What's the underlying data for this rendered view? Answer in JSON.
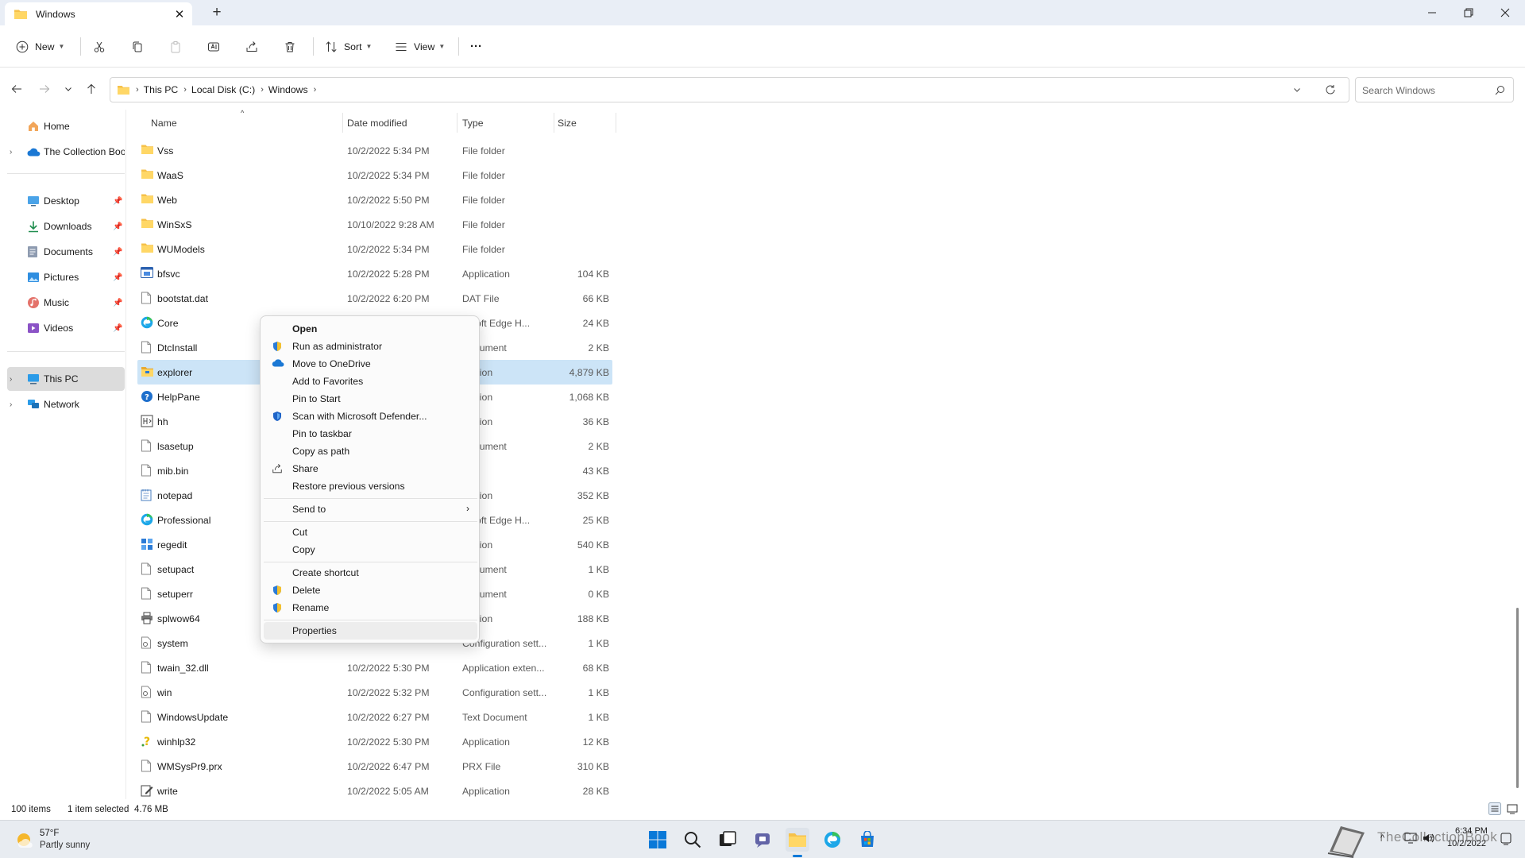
{
  "window": {
    "tab_title": "Windows",
    "new_tab": "+"
  },
  "toolbar": {
    "new_label": "New",
    "sort_label": "Sort",
    "view_label": "View",
    "more_label": "···"
  },
  "address": {
    "crumbs": [
      "This PC",
      "Local Disk (C:)",
      "Windows"
    ],
    "search_placeholder": "Search Windows"
  },
  "sidebar": {
    "home": "Home",
    "onedrive": "The Collection Boo",
    "pinned": [
      "Desktop",
      "Downloads",
      "Documents",
      "Pictures",
      "Music",
      "Videos"
    ],
    "this_pc": "This PC",
    "network": "Network"
  },
  "columns": {
    "name": "Name",
    "date": "Date modified",
    "type": "Type",
    "size": "Size"
  },
  "files": [
    {
      "name": "Vss",
      "date": "10/2/2022 5:34 PM",
      "type": "File folder",
      "size": "",
      "icon": "folder-icon"
    },
    {
      "name": "WaaS",
      "date": "10/2/2022 5:34 PM",
      "type": "File folder",
      "size": "",
      "icon": "folder-icon"
    },
    {
      "name": "Web",
      "date": "10/2/2022 5:50 PM",
      "type": "File folder",
      "size": "",
      "icon": "folder-icon"
    },
    {
      "name": "WinSxS",
      "date": "10/10/2022 9:28 AM",
      "type": "File folder",
      "size": "",
      "icon": "folder-icon"
    },
    {
      "name": "WUModels",
      "date": "10/2/2022 5:34 PM",
      "type": "File folder",
      "size": "",
      "icon": "folder-icon"
    },
    {
      "name": "bfsvc",
      "date": "10/2/2022 5:28 PM",
      "type": "Application",
      "size": "104 KB",
      "icon": "app-icon"
    },
    {
      "name": "bootstat.dat",
      "date": "10/2/2022 6:20 PM",
      "type": "DAT File",
      "size": "66 KB",
      "icon": "file-icon"
    },
    {
      "name": "Core",
      "date": "",
      "type": "rosoft Edge H...",
      "size": "24 KB",
      "icon": "edge-icon"
    },
    {
      "name": "DtcInstall",
      "date": "",
      "type": "Document",
      "size": "2 KB",
      "icon": "file-icon"
    },
    {
      "name": "explorer",
      "date": "",
      "type": "lication",
      "size": "4,879 KB",
      "icon": "explorer-icon"
    },
    {
      "name": "HelpPane",
      "date": "",
      "type": "lication",
      "size": "1,068 KB",
      "icon": "help-icon"
    },
    {
      "name": "hh",
      "date": "",
      "type": "lication",
      "size": "36 KB",
      "icon": "hh-icon"
    },
    {
      "name": "lsasetup",
      "date": "",
      "type": "Document",
      "size": "2 KB",
      "icon": "file-icon"
    },
    {
      "name": "mib.bin",
      "date": "",
      "type": "File",
      "size": "43 KB",
      "icon": "file-icon"
    },
    {
      "name": "notepad",
      "date": "",
      "type": "lication",
      "size": "352 KB",
      "icon": "notepad-icon"
    },
    {
      "name": "Professional",
      "date": "",
      "type": "rosoft Edge H...",
      "size": "25 KB",
      "icon": "edge-icon"
    },
    {
      "name": "regedit",
      "date": "",
      "type": "lication",
      "size": "540 KB",
      "icon": "regedit-icon"
    },
    {
      "name": "setupact",
      "date": "",
      "type": "Document",
      "size": "1 KB",
      "icon": "file-icon"
    },
    {
      "name": "setuperr",
      "date": "",
      "type": "Document",
      "size": "0 KB",
      "icon": "file-icon"
    },
    {
      "name": "splwow64",
      "date": "",
      "type": "lication",
      "size": "188 KB",
      "icon": "printer-icon"
    },
    {
      "name": "system",
      "date": "",
      "type": "Configuration sett...",
      "size": "1 KB",
      "icon": "config-icon"
    },
    {
      "name": "twain_32.dll",
      "date": "10/2/2022 5:30 PM",
      "type": "Application exten...",
      "size": "68 KB",
      "icon": "file-icon"
    },
    {
      "name": "win",
      "date": "10/2/2022 5:32 PM",
      "type": "Configuration sett...",
      "size": "1 KB",
      "icon": "config-icon"
    },
    {
      "name": "WindowsUpdate",
      "date": "10/2/2022 6:27 PM",
      "type": "Text Document",
      "size": "1 KB",
      "icon": "file-icon"
    },
    {
      "name": "winhlp32",
      "date": "10/2/2022 5:30 PM",
      "type": "Application",
      "size": "12 KB",
      "icon": "winhlp-icon"
    },
    {
      "name": "WMSysPr9.prx",
      "date": "10/2/2022 6:47 PM",
      "type": "PRX File",
      "size": "310 KB",
      "icon": "file-icon"
    },
    {
      "name": "write",
      "date": "10/2/2022 5:05 AM",
      "type": "Application",
      "size": "28 KB",
      "icon": "write-icon"
    }
  ],
  "context_menu": {
    "open": "Open",
    "run_admin": "Run as administrator",
    "move_onedrive": "Move to OneDrive",
    "add_favorites": "Add to Favorites",
    "pin_start": "Pin to Start",
    "scan": "Scan with Microsoft Defender...",
    "pin_taskbar": "Pin to taskbar",
    "copy_path": "Copy as path",
    "share": "Share",
    "restore": "Restore previous versions",
    "send_to": "Send to",
    "cut": "Cut",
    "copy": "Copy",
    "create_shortcut": "Create shortcut",
    "delete": "Delete",
    "rename": "Rename",
    "properties": "Properties"
  },
  "status": {
    "count": "100 items",
    "selected": "1 item selected",
    "size": "4.76 MB"
  },
  "taskbar": {
    "temp": "57°F",
    "weather": "Partly sunny",
    "time": "6:34 PM",
    "date": "10/2/2022",
    "watermark": "TheCollectionBook"
  }
}
